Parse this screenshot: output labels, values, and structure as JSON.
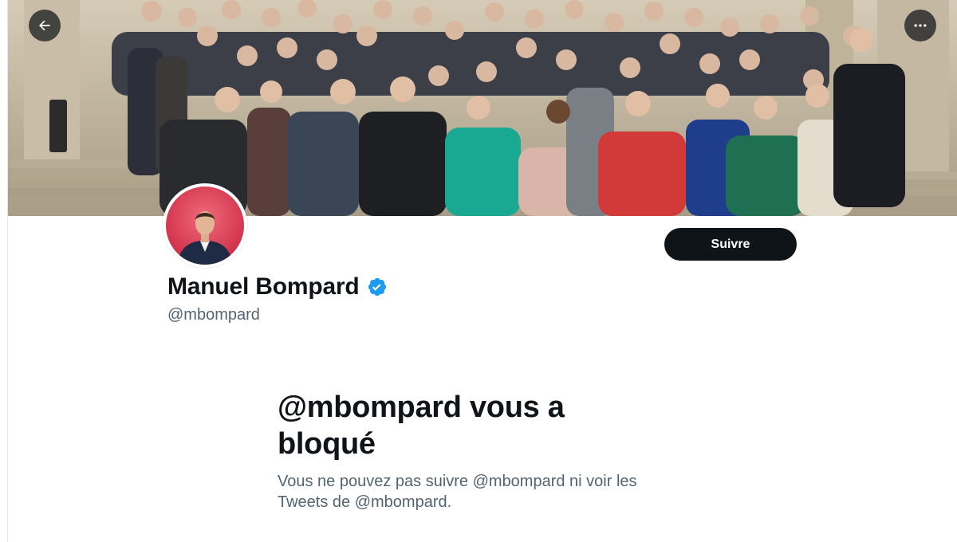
{
  "header": {
    "back_icon": "arrow-left-icon",
    "more_icon": "more-horizontal-icon"
  },
  "banner": {
    "description_icon": "group-photo-image"
  },
  "profile": {
    "name": "Manuel Bompard",
    "handle": "@mbompard",
    "verified_icon": "verified-badge-icon",
    "follow_label": "Suivre"
  },
  "blocked": {
    "title": "@mbompard vous a bloqué",
    "description": "Vous ne pouvez pas suivre @mbompard ni voir les Tweets de @mbompard."
  },
  "colors": {
    "text_primary": "#0f1419",
    "text_secondary": "#536471",
    "verified_blue": "#1d9bf0",
    "button_bg": "#0f1419"
  }
}
